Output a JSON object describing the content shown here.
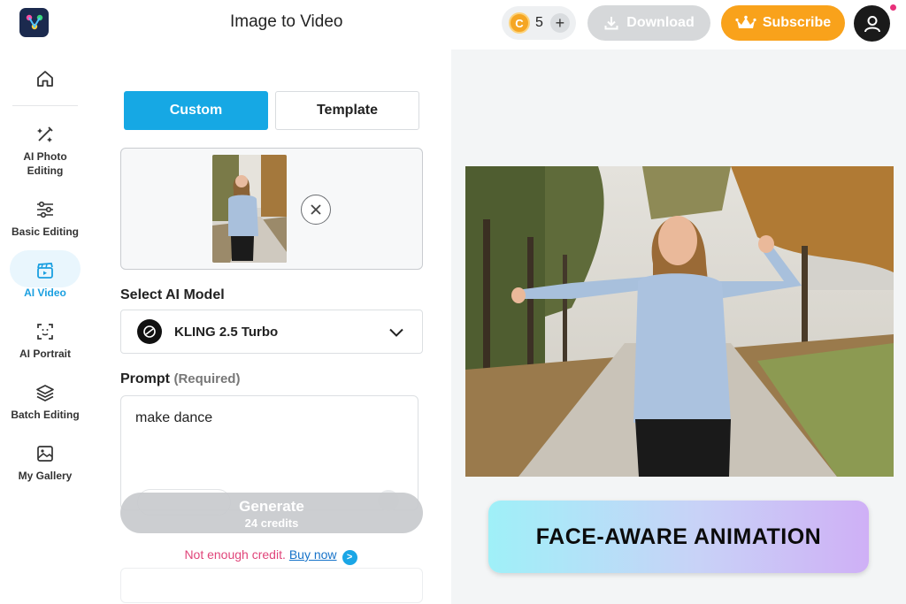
{
  "header": {
    "title": "Image to Video",
    "credits": "5",
    "coin_letter": "C",
    "download_label": "Download",
    "subscribe_label": "Subscribe"
  },
  "sidebar": {
    "items": [
      {
        "label": "Home",
        "icon": "home-icon"
      },
      {
        "label": "AI Photo Editing",
        "icon": "magic-wand-icon"
      },
      {
        "label": "Basic Editing",
        "icon": "sliders-icon"
      },
      {
        "label": "AI Video",
        "icon": "clapperboard-icon",
        "active": true
      },
      {
        "label": "AI Portrait",
        "icon": "face-scan-icon"
      },
      {
        "label": "Batch Editing",
        "icon": "layers-icon"
      },
      {
        "label": "My Gallery",
        "icon": "image-icon"
      }
    ],
    "ai_photo_line1": "AI Photo",
    "ai_photo_line2": "Editing"
  },
  "panel": {
    "tabs": {
      "custom": "Custom",
      "template": "Template"
    },
    "model_label": "Select AI Model",
    "model_name": "KLING 2.5 Turbo",
    "prompt_label": "Prompt",
    "prompt_required": "(Required)",
    "prompt_value": "make dance",
    "generate_label": "Generate",
    "generate_cost": "24 credits",
    "notice_text": "Not enough credit.",
    "buy_now": "Buy now"
  },
  "preview": {
    "badge_text": "FACE-AWARE ANIMATION"
  },
  "colors": {
    "accent": "#16a8e4",
    "subscribe": "#f9a21b",
    "notice": "#e0457a"
  }
}
